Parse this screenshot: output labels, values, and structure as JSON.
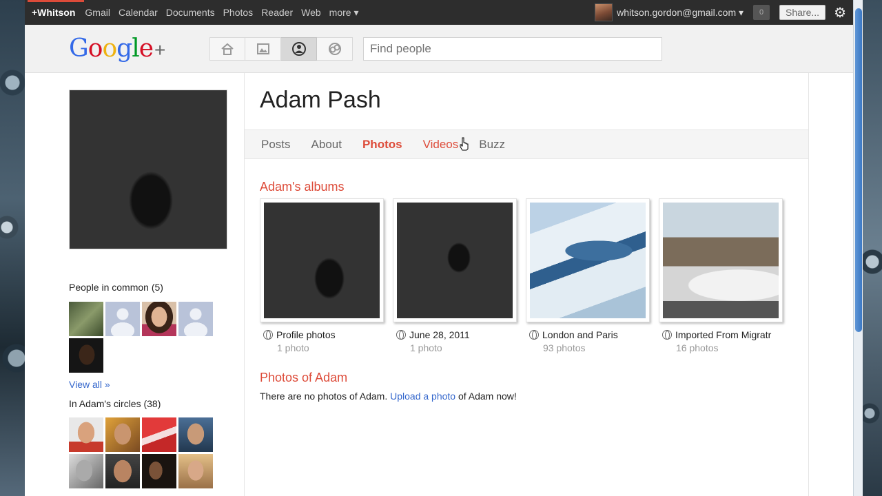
{
  "gbar": {
    "items": [
      "+Whitson",
      "Gmail",
      "Calendar",
      "Documents",
      "Photos",
      "Reader",
      "Web",
      "more ▾"
    ],
    "email": "whitson.gordon@gmail.com ▾",
    "notifications": "0",
    "share": "Share...",
    "accent_color": "#dd4b39"
  },
  "header": {
    "logo": {
      "g1": "G",
      "o1": "o",
      "o2": "o",
      "g2": "g",
      "l": "l",
      "e": "e",
      "plus": "+"
    },
    "nav_icons": [
      "home-icon",
      "photos-icon",
      "profile-icon",
      "circles-icon"
    ],
    "search_placeholder": "Find people"
  },
  "profile": {
    "name": "Adam Pash",
    "tabs": [
      "Posts",
      "About",
      "Photos",
      "Videos",
      "Buzz"
    ],
    "active_tab": "Photos"
  },
  "sidebar": {
    "people_in_common": "People in common (5)",
    "view_all": "View all »",
    "in_circles": "In Adam's circles (38)"
  },
  "albums_section": {
    "title": "Adam's albums",
    "albums": [
      {
        "name": "Profile photos",
        "count": "1 photo"
      },
      {
        "name": "June 28, 2011",
        "count": "1 photo"
      },
      {
        "name": "London and Paris",
        "count": "93 photos"
      },
      {
        "name": "Imported From Migratr",
        "count": "16 photos"
      }
    ]
  },
  "photos_of_section": {
    "title": "Photos of Adam",
    "text_before": "There are no photos of Adam. ",
    "link": "Upload a photo",
    "text_after": " of Adam now!"
  }
}
